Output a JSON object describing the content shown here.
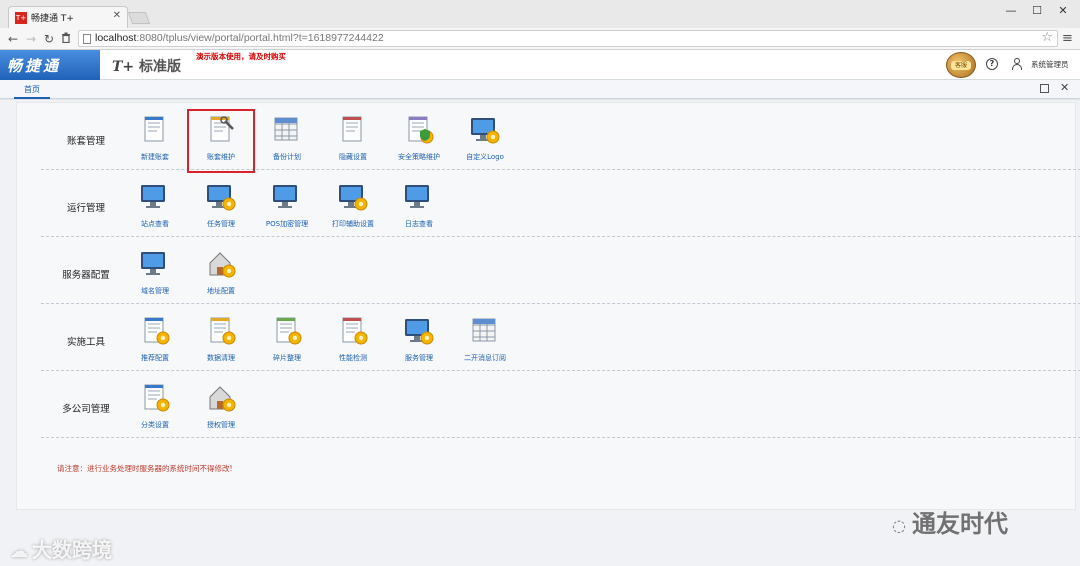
{
  "browser": {
    "tab_title": "畅捷通 T+",
    "tab_favicon": "T+",
    "url_host": "localhost",
    "url_rest": ":8080/tplus/view/portal/portal.html?t=1618977244422",
    "window_controls": [
      "—",
      "☐",
      "✕"
    ]
  },
  "header": {
    "brand": "畅捷通",
    "product_prefix": "T+",
    "product_name": "标准版",
    "demo_note": "演示版本使用，请及时购买",
    "mascot_tag": "客服",
    "user_name": "系统管理员"
  },
  "tabs": {
    "home": "首页"
  },
  "sections": [
    {
      "title": "账套管理",
      "items": [
        {
          "label": "新建账套",
          "icon": "new-account-book-icon"
        },
        {
          "label": "账套维护",
          "icon": "account-maintenance-icon",
          "highlighted": true
        },
        {
          "label": "备份计划",
          "icon": "backup-plan-icon"
        },
        {
          "label": "隐藏设置",
          "icon": "hide-settings-icon"
        },
        {
          "label": "安全策略维护",
          "icon": "security-policy-icon"
        },
        {
          "label": "自定义Logo",
          "icon": "custom-logo-icon"
        }
      ]
    },
    {
      "title": "运行管理",
      "items": [
        {
          "label": "站点查看",
          "icon": "site-view-icon"
        },
        {
          "label": "任务管理",
          "icon": "task-management-icon"
        },
        {
          "label": "POS加密管理",
          "icon": "pos-encryption-icon"
        },
        {
          "label": "打印辅助设置",
          "icon": "print-assist-icon"
        },
        {
          "label": "日志查看",
          "icon": "log-view-icon"
        }
      ]
    },
    {
      "title": "服务器配置",
      "items": [
        {
          "label": "域名管理",
          "icon": "domain-management-icon"
        },
        {
          "label": "地址配置",
          "icon": "address-config-icon"
        }
      ]
    },
    {
      "title": "实施工具",
      "items": [
        {
          "label": "推荐配置",
          "icon": "recommended-config-icon"
        },
        {
          "label": "数据清理",
          "icon": "data-cleanup-icon"
        },
        {
          "label": "碎片整理",
          "icon": "defragment-icon"
        },
        {
          "label": "性能检测",
          "icon": "performance-check-icon"
        },
        {
          "label": "服务管理",
          "icon": "service-management-icon"
        },
        {
          "label": "二开消息订阅",
          "icon": "message-subscription-icon"
        }
      ]
    },
    {
      "title": "多公司管理",
      "items": [
        {
          "label": "分类设置",
          "icon": "category-settings-icon"
        },
        {
          "label": "授权管理",
          "icon": "authorization-icon"
        }
      ]
    }
  ],
  "notice": "请注意：进行业务处理时服务器的系统时间不得修改!",
  "watermarks": {
    "left": "大数跨境",
    "right": "通友时代"
  }
}
